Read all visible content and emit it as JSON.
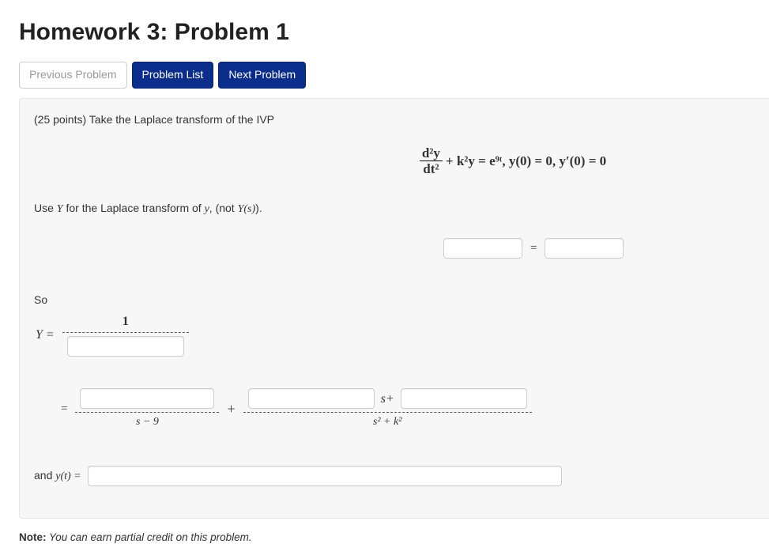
{
  "page_title": "Homework 3: Problem 1",
  "nav": {
    "previous": "Previous Problem",
    "list": "Problem List",
    "next": "Next Problem"
  },
  "problem": {
    "intro": "(25 points) Take the Laplace transform of the IVP",
    "equation": {
      "frac_num": "d²y",
      "frac_den": "dt²",
      "rest": " + k²y = e⁹ᵗ, y(0) = 0, y′(0) = 0"
    },
    "instr2_a": "Use ",
    "instr2_Y": "Y",
    "instr2_b": " for the Laplace transform of ",
    "instr2_y": "y",
    "instr2_c": ", (not ",
    "instr2_Ys": "Y(s)",
    "instr2_d": ").",
    "eq_sign": "=",
    "so": "So",
    "Yeq_lhs": "Y =",
    "one": "1",
    "plus": "+",
    "s_plus": "s+",
    "s_minus_9": "s − 9",
    "s2_plus_k2": "s² + k²",
    "and_yt_a": "and ",
    "and_yt_b": "y(t) = ",
    "note_label": "Note:",
    "note_text": " You can earn partial credit on this problem."
  },
  "inputs": {
    "lhs": "",
    "rhs": "",
    "denom1": "",
    "num2": "",
    "num3a": "",
    "num3b": "",
    "yt": ""
  }
}
